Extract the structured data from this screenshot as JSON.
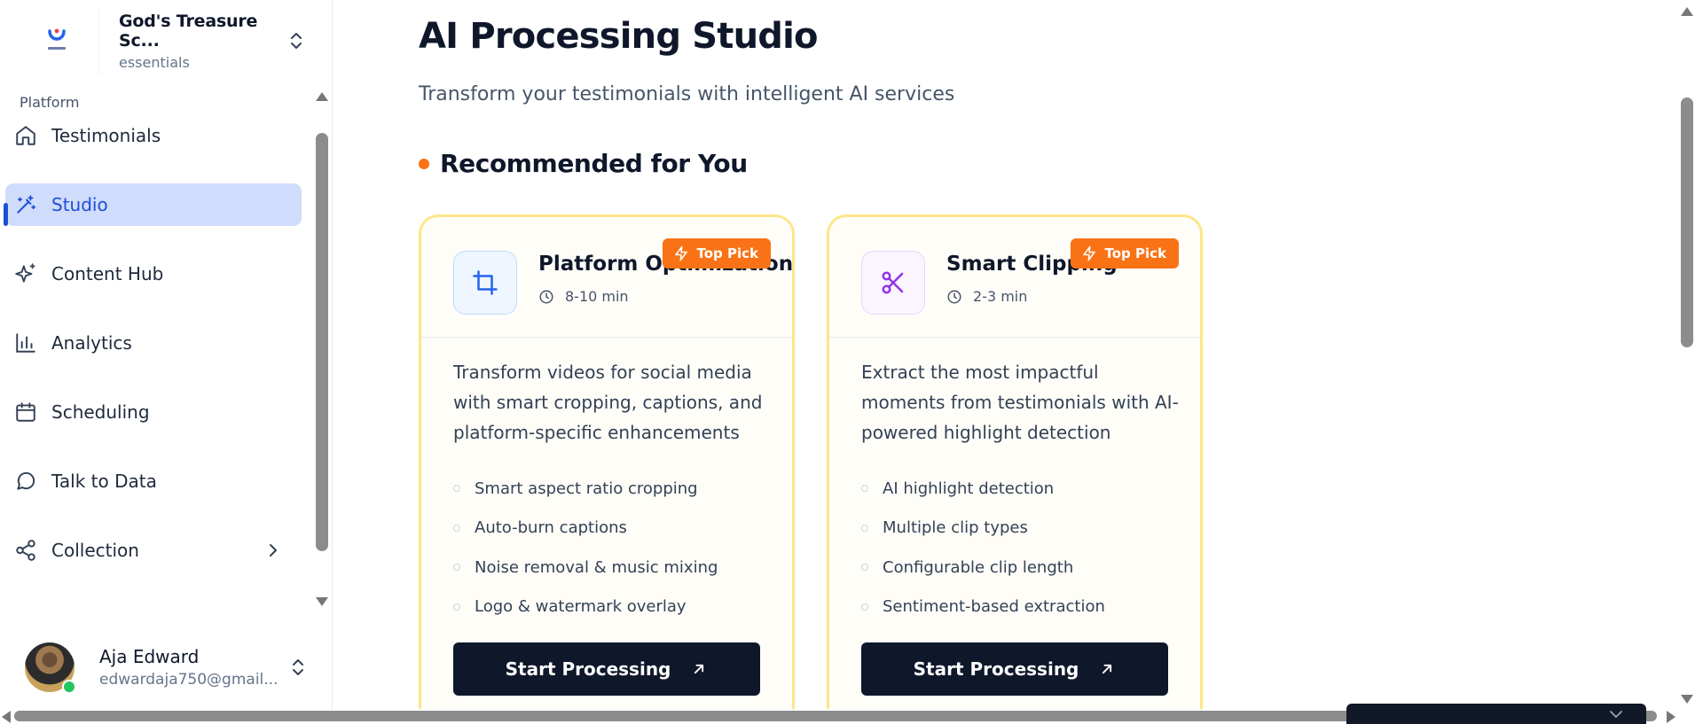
{
  "workspace": {
    "name": "God's Treasure Sc...",
    "plan": "essentials",
    "logo_text": "ESSENTIALS"
  },
  "sidebar": {
    "group_label": "Platform",
    "items": [
      {
        "label": "Testimonials",
        "icon": "home-icon"
      },
      {
        "label": "Studio",
        "icon": "magic-wand-icon",
        "active": true
      },
      {
        "label": "Content Hub",
        "icon": "sparkles-icon"
      },
      {
        "label": "Analytics",
        "icon": "bar-chart-icon"
      },
      {
        "label": "Scheduling",
        "icon": "calendar-icon"
      },
      {
        "label": "Talk to Data",
        "icon": "chat-bubble-icon"
      },
      {
        "label": "Collection",
        "icon": "share-icon",
        "has_submenu": true
      }
    ]
  },
  "user": {
    "name": "Aja Edward",
    "email": "edwardaja750@gmail...",
    "status": "online"
  },
  "page": {
    "title": "AI Processing Studio",
    "subtitle": "Transform your testimonials with intelligent AI services",
    "section_title": "Recommended for You"
  },
  "cards": [
    {
      "title": "Platform Optimization",
      "time": "8-10 min",
      "badge": "Top Pick",
      "icon": "crop-icon",
      "description": "Transform videos for social media with smart cropping, captions, and platform-specific enhancements",
      "features": [
        "Smart aspect ratio cropping",
        "Auto-burn captions",
        "Noise removal & music mixing",
        "Logo & watermark overlay"
      ],
      "cta": "Start Processing"
    },
    {
      "title": "Smart Clipping",
      "time": "2-3 min",
      "badge": "Top Pick",
      "icon": "scissors-icon",
      "description": "Extract the most impactful moments from testimonials with AI-powered highlight detection",
      "features": [
        "AI highlight detection",
        "Multiple clip types",
        "Configurable clip length",
        "Sentiment-based extraction"
      ],
      "cta": "Start Processing"
    }
  ],
  "colors": {
    "accent": "#1d4ed8",
    "active_bg": "#cfdcfb",
    "badge": "#f97316",
    "card_border": "#fde68a",
    "cta_bg": "#0f172a",
    "online": "#22c55e"
  }
}
